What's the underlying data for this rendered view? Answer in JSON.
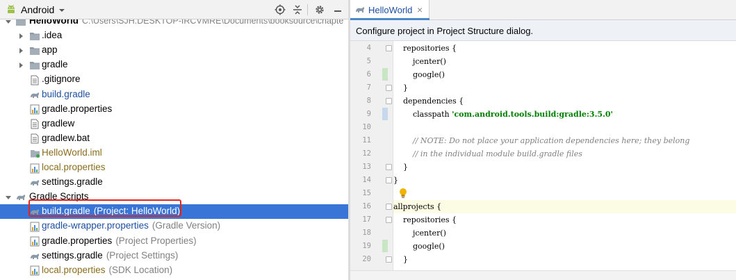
{
  "left_toolbar": {
    "view_label": "Android"
  },
  "tree": [
    {
      "label": "HelloWorld",
      "hint": "C:\\Users\\SJH.DESKTOP-IRCVMRE\\Documents\\booksource\\chapte",
      "icon": "folder-icon",
      "level": 0
    },
    {
      "label": ".idea",
      "hint": "",
      "icon": "folder-icon",
      "level": 1
    },
    {
      "label": "app",
      "hint": "",
      "icon": "folder-icon",
      "level": 1
    },
    {
      "label": "gradle",
      "hint": "",
      "icon": "folder-icon",
      "level": 1
    },
    {
      "label": ".gitignore",
      "hint": "",
      "icon": "file-icon",
      "level": 1
    },
    {
      "label": "build.gradle",
      "hint": "",
      "icon": "gradle-icon",
      "level": 1
    },
    {
      "label": "gradle.properties",
      "hint": "",
      "icon": "properties-icon",
      "level": 1
    },
    {
      "label": "gradlew",
      "hint": "",
      "icon": "file-icon",
      "level": 1
    },
    {
      "label": "gradlew.bat",
      "hint": "",
      "icon": "file-icon",
      "level": 1
    },
    {
      "label": "HelloWorld.iml",
      "hint": "",
      "icon": "module-icon",
      "level": 1
    },
    {
      "label": "local.properties",
      "hint": "",
      "icon": "properties-icon",
      "level": 1
    },
    {
      "label": "settings.gradle",
      "hint": "",
      "icon": "gradle-icon",
      "level": 1
    },
    {
      "label": "Gradle Scripts",
      "hint": "",
      "icon": "gradle-icon",
      "level": 0
    },
    {
      "label": "build.gradle",
      "hint": "(Project: HelloWorld)",
      "icon": "gradle-icon",
      "level": 1
    },
    {
      "label": "gradle-wrapper.properties",
      "hint": "(Gradle Version)",
      "icon": "properties-icon",
      "level": 1
    },
    {
      "label": "gradle.properties",
      "hint": "(Project Properties)",
      "icon": "properties-icon",
      "level": 1
    },
    {
      "label": "settings.gradle",
      "hint": "(Project Settings)",
      "icon": "gradle-icon",
      "level": 1
    },
    {
      "label": "local.properties",
      "hint": "(SDK Location)",
      "icon": "properties-icon",
      "level": 1
    }
  ],
  "editor": {
    "tab_label": "HelloWorld",
    "banner": "Configure project in Project Structure dialog.",
    "lines": [
      {
        "n": "4",
        "code": "    repositories {"
      },
      {
        "n": "5",
        "code": "        jcenter()"
      },
      {
        "n": "6",
        "code": "        google()"
      },
      {
        "n": "7",
        "code": "    }"
      },
      {
        "n": "8",
        "code": "    dependencies {"
      },
      {
        "n": "9",
        "code": "        classpath 'com.android.tools.build:gradle:3.5.0'"
      },
      {
        "n": "10",
        "code": ""
      },
      {
        "n": "11",
        "code": "        // NOTE: Do not place your application dependencies here; they belong"
      },
      {
        "n": "12",
        "code": "        // in the individual module build.gradle files"
      },
      {
        "n": "13",
        "code": "    }"
      },
      {
        "n": "14",
        "code": "}"
      },
      {
        "n": "15",
        "code": ""
      },
      {
        "n": "16",
        "code": "allprojects {"
      },
      {
        "n": "17",
        "code": "    repositories {"
      },
      {
        "n": "18",
        "code": "        jcenter()"
      },
      {
        "n": "19",
        "code": "        google()"
      },
      {
        "n": "20",
        "code": "    }"
      }
    ]
  },
  "colors": {
    "selection": "#3875d7",
    "highlight_box": "#e0261c",
    "keyword": "#000080",
    "string": "#008000",
    "comment": "#808080",
    "link_blue": "#1d4fa0",
    "olive_text": "#8a6d1e"
  }
}
